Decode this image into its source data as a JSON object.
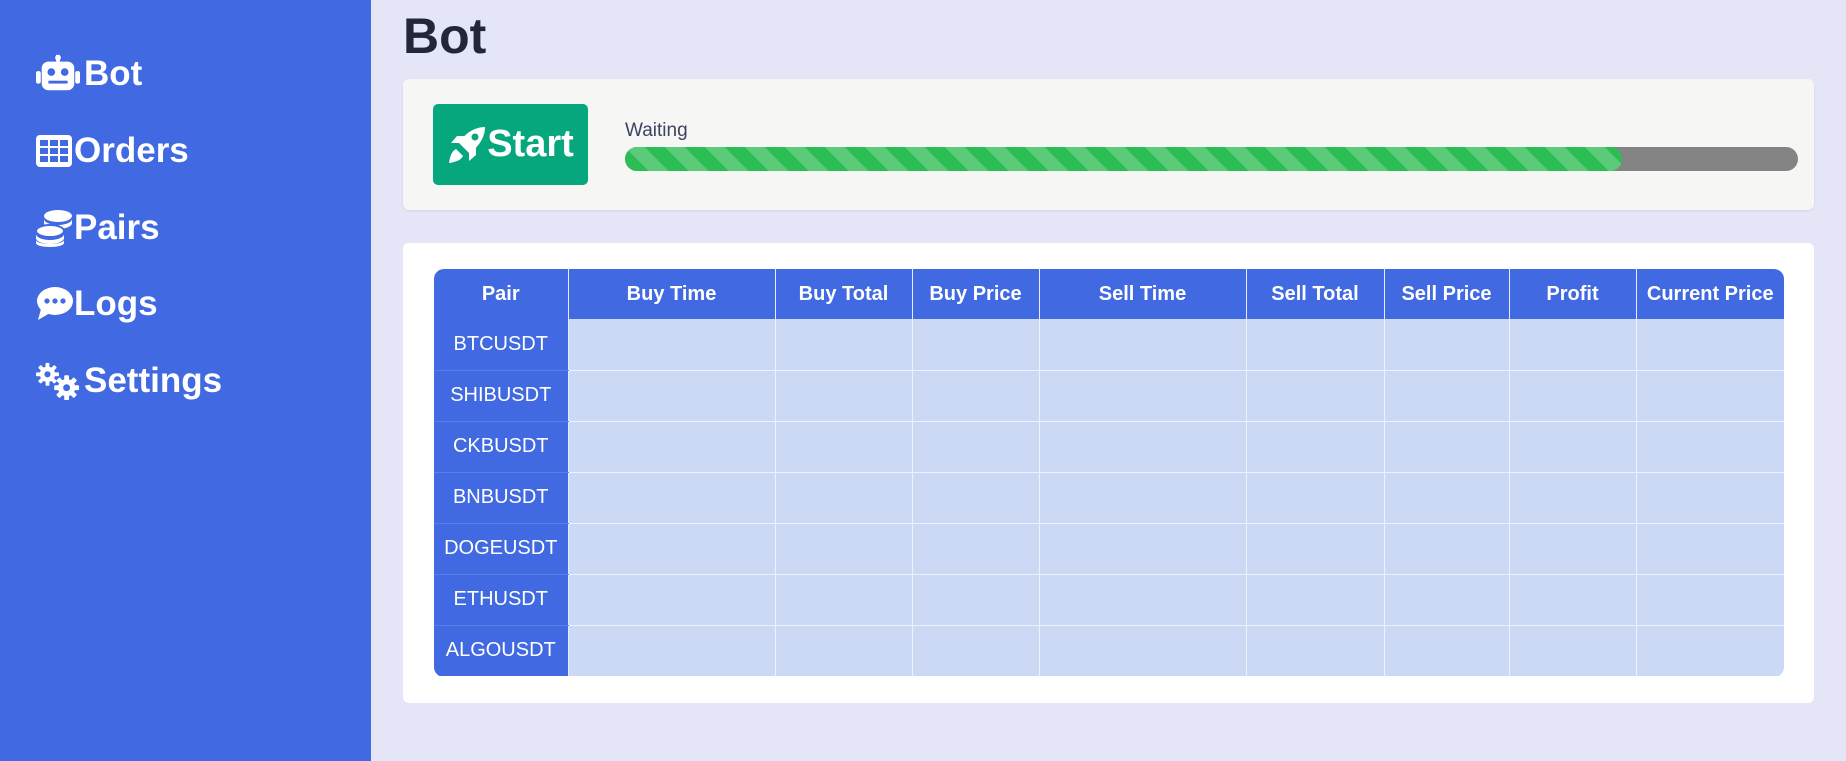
{
  "sidebar": {
    "items": [
      {
        "label": "Bot",
        "icon": "robot-icon"
      },
      {
        "label": "Orders",
        "icon": "table-icon"
      },
      {
        "label": "Pairs",
        "icon": "coins-icon"
      },
      {
        "label": "Logs",
        "icon": "comment-icon"
      },
      {
        "label": "Settings",
        "icon": "gears-icon"
      }
    ]
  },
  "page": {
    "title": "Bot"
  },
  "controls": {
    "start_label": "Start",
    "start_icon": "rocket-icon",
    "status": "Waiting",
    "progress_fraction": 0.85
  },
  "table": {
    "headers": [
      "Pair",
      "Buy Time",
      "Buy Total",
      "Buy Price",
      "Sell Time",
      "Sell Total",
      "Sell Price",
      "Profit",
      "Current Price"
    ],
    "rows": [
      [
        "BTCUSDT",
        "",
        "",
        "",
        "",
        "",
        "",
        "",
        ""
      ],
      [
        "SHIBUSDT",
        "",
        "",
        "",
        "",
        "",
        "",
        "",
        ""
      ],
      [
        "CKBUSDT",
        "",
        "",
        "",
        "",
        "",
        "",
        "",
        ""
      ],
      [
        "BNBUSDT",
        "",
        "",
        "",
        "",
        "",
        "",
        "",
        ""
      ],
      [
        "DOGEUSDT",
        "",
        "",
        "",
        "",
        "",
        "",
        "",
        ""
      ],
      [
        "ETHUSDT",
        "",
        "",
        "",
        "",
        "",
        "",
        "",
        ""
      ],
      [
        "ALGOUSDT",
        "",
        "",
        "",
        "",
        "",
        "",
        "",
        ""
      ]
    ]
  },
  "colors": {
    "sidebar_bg": "#4169e1",
    "page_bg": "#e4e5f7",
    "start_button": "#06a77d",
    "progress_fill": "#2dbd55",
    "progress_track": "#848484",
    "table_header": "#4169e1",
    "table_cell": "#ccd9f4"
  }
}
